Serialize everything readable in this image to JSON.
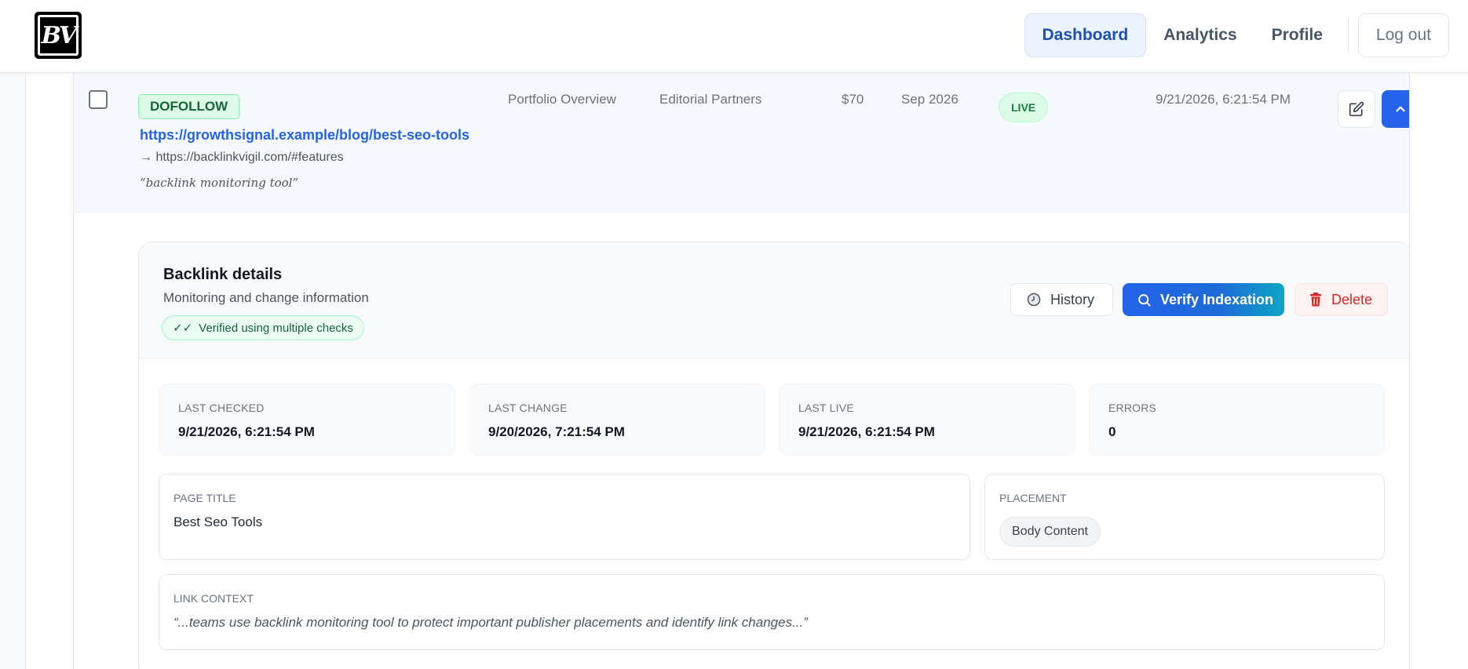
{
  "header": {
    "logo_text": "BV",
    "nav": {
      "dashboard": "Dashboard",
      "analytics": "Analytics",
      "profile": "Profile",
      "logout": "Log out"
    }
  },
  "row": {
    "type_badge": "DOFOLLOW",
    "source_url": "https://growthsignal.example/blog/best-seo-tools",
    "target_url": "→ https://backlinkvigil.com/#features",
    "anchor_text": "“backlink monitoring tool”",
    "project": "Portfolio Overview",
    "vendor": "Editorial Partners",
    "price": "$70",
    "expiry": "Sep 2026",
    "status": "LIVE",
    "last_checked": "9/21/2026, 6:21:54 PM"
  },
  "details": {
    "title": "Backlink details",
    "subtitle": "Monitoring and change information",
    "verified_label": "Verified using multiple checks",
    "buttons": {
      "history": "History",
      "verify": "Verify Indexation",
      "delete": "Delete"
    },
    "stats": {
      "last_checked_label": "LAST CHECKED",
      "last_checked_value": "9/21/2026, 6:21:54 PM",
      "last_change_label": "LAST CHANGE",
      "last_change_value": "9/20/2026, 7:21:54 PM",
      "last_live_label": "LAST LIVE",
      "last_live_value": "9/21/2026, 6:21:54 PM",
      "errors_label": "ERRORS",
      "errors_value": "0"
    },
    "page_title_label": "PAGE TITLE",
    "page_title_value": "Best Seo Tools",
    "placement_label": "PLACEMENT",
    "placement_value": "Body Content",
    "context_label": "LINK CONTEXT",
    "context_value": "“...teams use backlink monitoring tool to protect important publisher placements and identify link changes...”"
  },
  "colors": {
    "accent": "#2563eb",
    "live_green": "#15803d",
    "delete_red": "#dc2626"
  }
}
